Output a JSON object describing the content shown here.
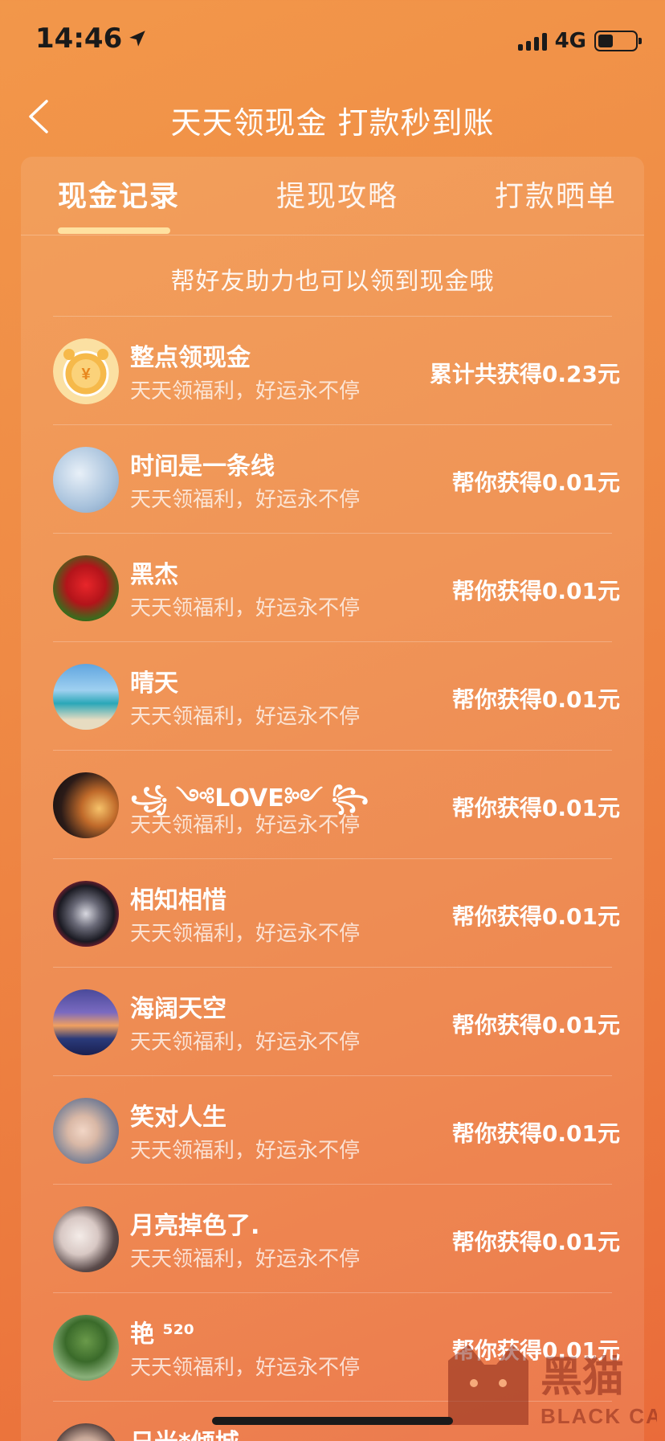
{
  "status_bar": {
    "time": "14:46",
    "network": "4G"
  },
  "nav": {
    "title": "天天领现金 打款秒到账"
  },
  "tabs": [
    {
      "label": "现金记录",
      "active": true
    },
    {
      "label": "提现攻略",
      "active": false
    },
    {
      "label": "打款晒单",
      "active": false
    }
  ],
  "subtitle": "帮好友助力也可以领到现金哦",
  "records": [
    {
      "name": "整点领现金",
      "desc": "天天领福利，好运永不停",
      "value": "累计共获得0.23元",
      "avatar": "alarm-clock"
    },
    {
      "name": "时间是一条线",
      "desc": "天天领福利，好运永不停",
      "value": "帮你获得0.01元",
      "avatar": "sky"
    },
    {
      "name": "黑杰",
      "desc": "天天领福利，好运永不停",
      "value": "帮你获得0.01元",
      "avatar": "rose"
    },
    {
      "name": "晴天",
      "desc": "天天领福利，好运永不停",
      "value": "帮你获得0.01元",
      "avatar": "beach"
    },
    {
      "name": "꧁ ༺LOVE༻ ꧂",
      "desc": "天天领福利，好运永不停",
      "value": "帮你获得0.01元",
      "avatar": "sunset"
    },
    {
      "name": "相知相惜",
      "desc": "天天领福利，好运永不停",
      "value": "帮你获得0.01元",
      "avatar": "anime"
    },
    {
      "name": "海阔天空",
      "desc": "天天领福利，好运永不停",
      "value": "帮你获得0.01元",
      "avatar": "city"
    },
    {
      "name": "笑对人生",
      "desc": "天天领福利，好运永不停",
      "value": "帮你获得0.01元",
      "avatar": "child"
    },
    {
      "name": "月亮掉色了.",
      "desc": "天天领福利，好运永不停",
      "value": "帮你获得0.01元",
      "avatar": "portrait"
    },
    {
      "name": "艳 ⁵²⁰",
      "desc": "天天领福利，好运永不停",
      "value": "帮你获得0.01元",
      "avatar": "tree"
    },
    {
      "name": "日光*倾城",
      "desc": "",
      "value": "",
      "avatar": "girl"
    }
  ],
  "watermark": {
    "cn": "黑猫",
    "en": "BLACK CAT"
  }
}
